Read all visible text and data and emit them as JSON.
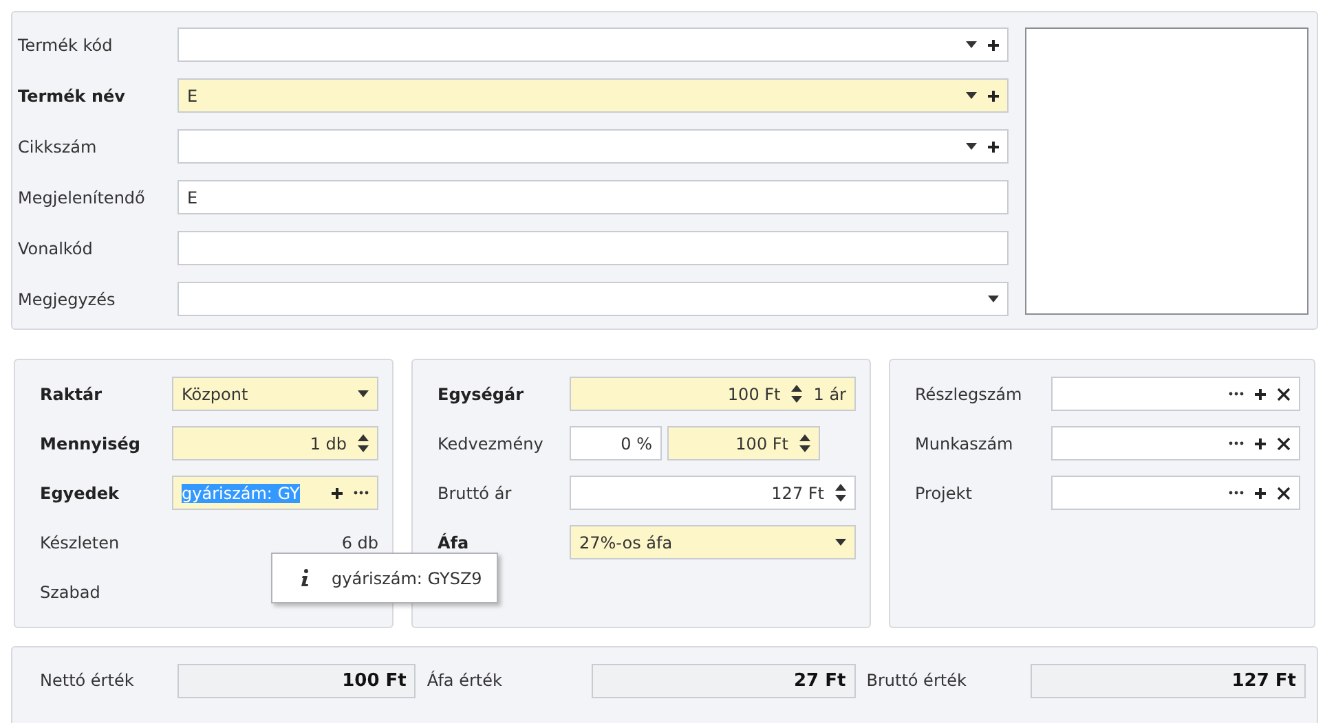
{
  "product": {
    "rows": [
      {
        "label": "Termék kód",
        "required": false,
        "inputs": [
          {
            "kind": "combo_add",
            "highlighted": false
          }
        ]
      },
      {
        "label": "Termék név",
        "required": true,
        "inputs": [
          {
            "kind": "combo_add",
            "value": "E",
            "highlighted": true
          }
        ]
      },
      {
        "label": "Cikkszám",
        "required": false,
        "inputs": [
          {
            "kind": "combo_add",
            "highlighted": false
          }
        ]
      },
      {
        "label": "Megjelenítendő",
        "required": false,
        "inputs": [
          {
            "kind": "text",
            "value": "E",
            "highlighted": false
          }
        ]
      },
      {
        "label": "Vonalkód",
        "required": false,
        "inputs": [
          {
            "kind": "text",
            "highlighted": false
          }
        ]
      },
      {
        "label": "Megjegyzés",
        "required": false,
        "inputs": [
          {
            "kind": "dropdown",
            "highlighted": false
          }
        ]
      }
    ]
  },
  "panels": [
    {
      "rows": [
        {
          "label": "Raktár",
          "required": true,
          "inputs": [
            {
              "kind": "dropdown",
              "value": "Központ",
              "highlighted": true
            }
          ]
        },
        {
          "label": "Mennyiség",
          "required": true,
          "inputs": [
            {
              "kind": "spin",
              "value": "1 db",
              "highlighted": true
            }
          ]
        },
        {
          "label": "Egyedek",
          "required": true,
          "inputs": [
            {
              "kind": "add_more",
              "value": "gyáriszám: GY",
              "highlighted": true,
              "text_selected": true
            }
          ]
        },
        {
          "label": "Készleten",
          "required": false,
          "inputs": [
            {
              "kind": "info",
              "value": "6 db"
            }
          ]
        },
        {
          "label": "Szabad",
          "required": false,
          "inputs": []
        }
      ]
    },
    {
      "rows": [
        {
          "label": "Egységár",
          "required": true,
          "inputs": [
            {
              "kind": "spin",
              "value": "100 Ft",
              "suffix": "1 ár",
              "highlighted": true
            }
          ]
        },
        {
          "label": "Kedvezmény",
          "required": false,
          "inputs": [
            {
              "kind": "text_right",
              "value": "0 %",
              "highlighted": false
            },
            {
              "kind": "spin",
              "value": "100 Ft",
              "highlighted": true
            }
          ]
        },
        {
          "label": "Bruttó ár",
          "required": false,
          "inputs": [
            {
              "kind": "spin",
              "value": "127 Ft",
              "highlighted": false
            }
          ]
        },
        {
          "label": "Áfa",
          "required": true,
          "inputs": [
            {
              "kind": "dropdown",
              "value": "27%-os áfa",
              "highlighted": true
            }
          ]
        }
      ]
    },
    {
      "rows": [
        {
          "label": "Részlegszám",
          "required": false,
          "inputs": [
            {
              "kind": "lookup",
              "highlighted": false
            }
          ]
        },
        {
          "label": "Munkaszám",
          "required": false,
          "inputs": [
            {
              "kind": "lookup",
              "highlighted": false
            }
          ]
        },
        {
          "label": "Projekt",
          "required": false,
          "inputs": [
            {
              "kind": "lookup",
              "highlighted": false
            }
          ]
        }
      ]
    }
  ],
  "tooltip": {
    "text": "gyáriszám: GYSZ9"
  },
  "totals": [
    {
      "label": "Nettó érték",
      "value": "100 Ft"
    },
    {
      "label": "Áfa érték",
      "value": "27 Ft"
    },
    {
      "label": "Bruttó érték",
      "value": "127 Ft"
    }
  ]
}
